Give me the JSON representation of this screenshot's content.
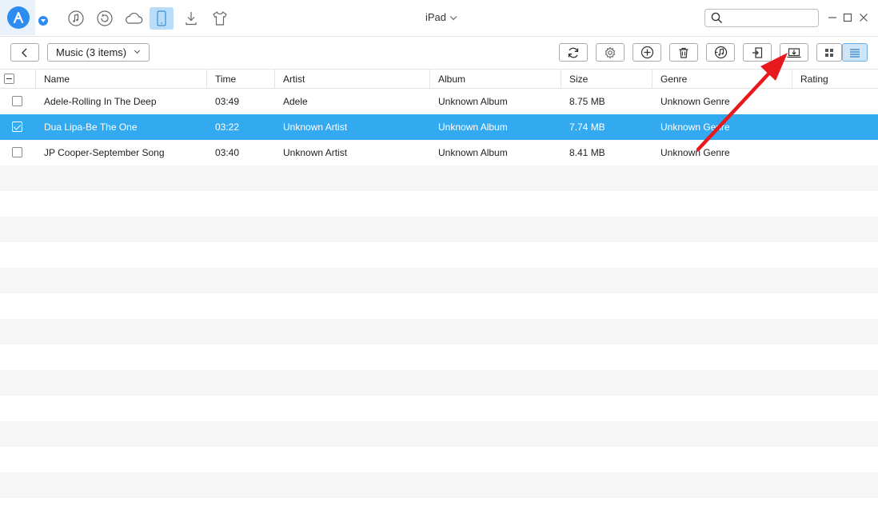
{
  "titlebar": {
    "device_name": "iPad",
    "search_placeholder": "",
    "nav_icons": [
      "music-note-icon",
      "history-icon",
      "cloud-icon",
      "phone-icon",
      "download-icon",
      "tshirt-icon"
    ],
    "active_nav": "phone-icon"
  },
  "toolbar": {
    "category_label": "Music (3 items)",
    "buttons": [
      "refresh-icon",
      "settings-icon",
      "add-icon",
      "delete-icon",
      "itunes-icon",
      "export-to-device-icon",
      "export-to-computer-icon"
    ],
    "view_modes": [
      "grid-view-icon",
      "list-view-icon"
    ],
    "active_view": "list-view-icon"
  },
  "table": {
    "columns": [
      "Name",
      "Time",
      "Artist",
      "Album",
      "Size",
      "Genre",
      "Rating"
    ],
    "rows": [
      {
        "name": "Adele-Rolling In The Deep",
        "time": "03:49",
        "artist": "Adele",
        "album": "Unknown Album",
        "size": "8.75 MB",
        "genre": "Unknown Genre",
        "rating": "",
        "checked": false
      },
      {
        "name": "Dua Lipa-Be The One",
        "time": "03:22",
        "artist": "Unknown Artist",
        "album": "Unknown Album",
        "size": "7.74 MB",
        "genre": "Unknown Genre",
        "rating": "",
        "checked": true
      },
      {
        "name": "JP Cooper-September Song",
        "time": "03:40",
        "artist": "Unknown Artist",
        "album": "Unknown Album",
        "size": "8.41 MB",
        "genre": "Unknown Genre",
        "rating": "",
        "checked": false
      }
    ],
    "selected_row": 1,
    "header_checkbox_state": "partial"
  },
  "annotation": {
    "arrow_color": "#e8191c",
    "target": "export-to-computer-button"
  },
  "colors": {
    "selection": "#33aaf0",
    "accent": "#2d8cf0",
    "active_nav_bg": "#b9dcf8"
  }
}
